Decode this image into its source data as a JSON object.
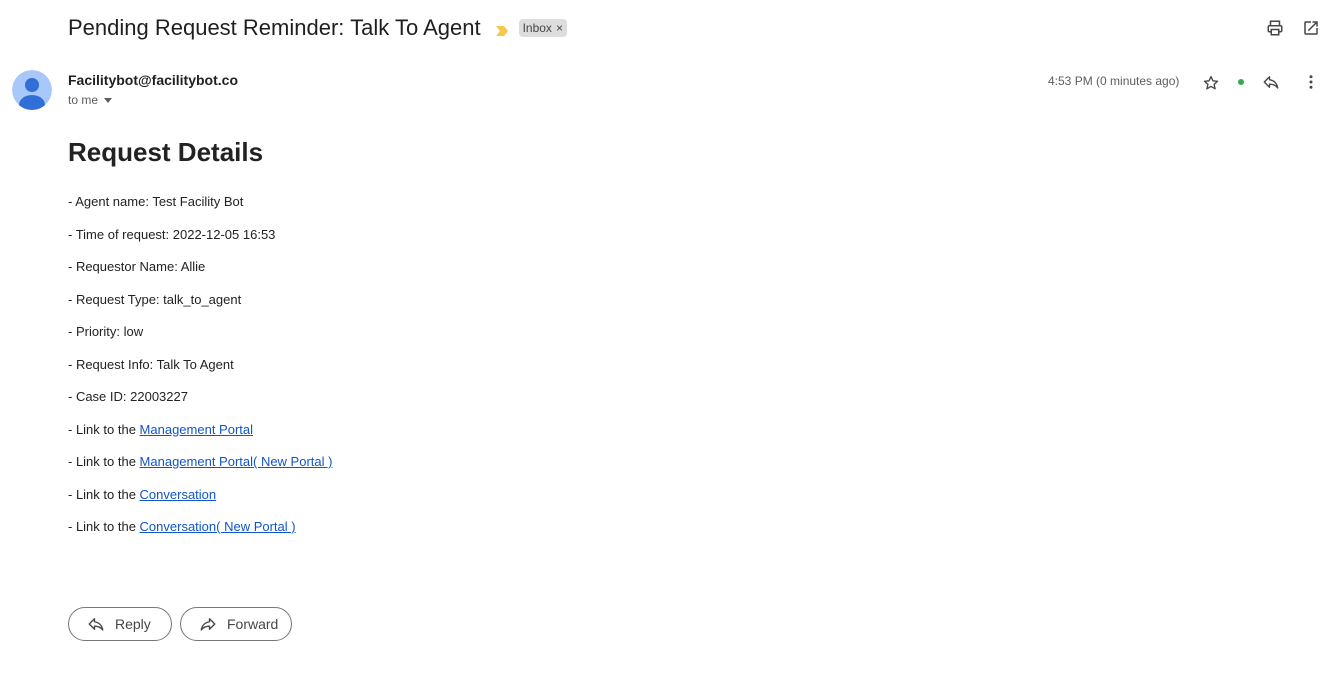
{
  "header": {
    "subject": "Pending Request Reminder: Talk To Agent",
    "label": "Inbox",
    "label_remove": "×",
    "importance_color": "#f2c94c"
  },
  "message": {
    "sender": "Facilitybot@facilitybot.co",
    "recipient": "to me",
    "timestamp": "4:53 PM (0 minutes ago)",
    "presence_color": "#34a853"
  },
  "body": {
    "title": "Request Details",
    "lines": [
      "- Agent name: Test Facility Bot",
      "- Time of request: 2022-12-05 16:53",
      "- Requestor Name: Allie",
      "- Request Type: talk_to_agent",
      "- Priority: low",
      "- Request Info: Talk To Agent",
      "- Case ID: 22003227"
    ],
    "links": [
      {
        "prefix": "- Link to the ",
        "text": "Management Portal"
      },
      {
        "prefix": "- Link to the ",
        "text": "Management Portal( New Portal )"
      },
      {
        "prefix": "- Link to the ",
        "text": "Conversation"
      },
      {
        "prefix": "- Link to the ",
        "text": "Conversation( New Portal )"
      }
    ],
    "link_color": "#1155cc"
  },
  "actions": {
    "reply": "Reply",
    "forward": "Forward"
  },
  "icons": {
    "print": "print-icon",
    "open_new_window": "open-in-new-window-icon",
    "star": "star-icon",
    "reply": "reply-icon",
    "more": "more-vertical-icon",
    "forward": "forward-icon",
    "avatar": "default-avatar-icon"
  }
}
